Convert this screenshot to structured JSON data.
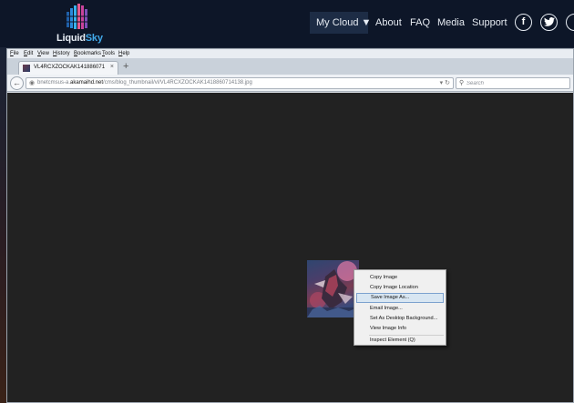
{
  "site": {
    "logo": {
      "part1": "Liquid",
      "part2": "Sky"
    },
    "nav": {
      "my_cloud": "My Cloud ▼",
      "about": "About",
      "faq": "FAQ",
      "media": "Media",
      "support": "Support"
    },
    "social": {
      "facebook": "f",
      "twitter": "t"
    }
  },
  "browser": {
    "menu": [
      "File",
      "Edit",
      "View",
      "History",
      "Bookmarks",
      "Tools",
      "Help"
    ],
    "tab": {
      "title": "VL4RCXZOCKAK141886071413...",
      "close": "×",
      "new_tab": "+"
    },
    "url": {
      "prefix": "bnetcmsus-a.",
      "domain": "akamaihd.net",
      "path": "/cms/blog_thumbnail/vl/VL4RCXZOCKAK1418860714138.jpg"
    },
    "search": {
      "placeholder": "Search"
    },
    "icons": {
      "back": "back-arrow-icon",
      "globe": "globe-icon",
      "search": "search-icon"
    }
  },
  "context_menu": {
    "items": [
      {
        "label": "Copy Image",
        "highlighted": false
      },
      {
        "label": "Copy Image Location",
        "highlighted": false
      },
      {
        "label": "Save Image As...",
        "highlighted": true
      },
      {
        "label": "Email Image...",
        "highlighted": false
      },
      {
        "label": "Set As Desktop Background...",
        "highlighted": false
      },
      {
        "label": "View Image Info",
        "highlighted": false
      },
      {
        "label": "Inspect Element (Q)",
        "highlighted": false
      }
    ]
  },
  "colors": {
    "site_bg": "#0d1628",
    "accent": "#41a9ea",
    "page_bg": "#222222",
    "menu_highlight": "#d8e6f2"
  }
}
